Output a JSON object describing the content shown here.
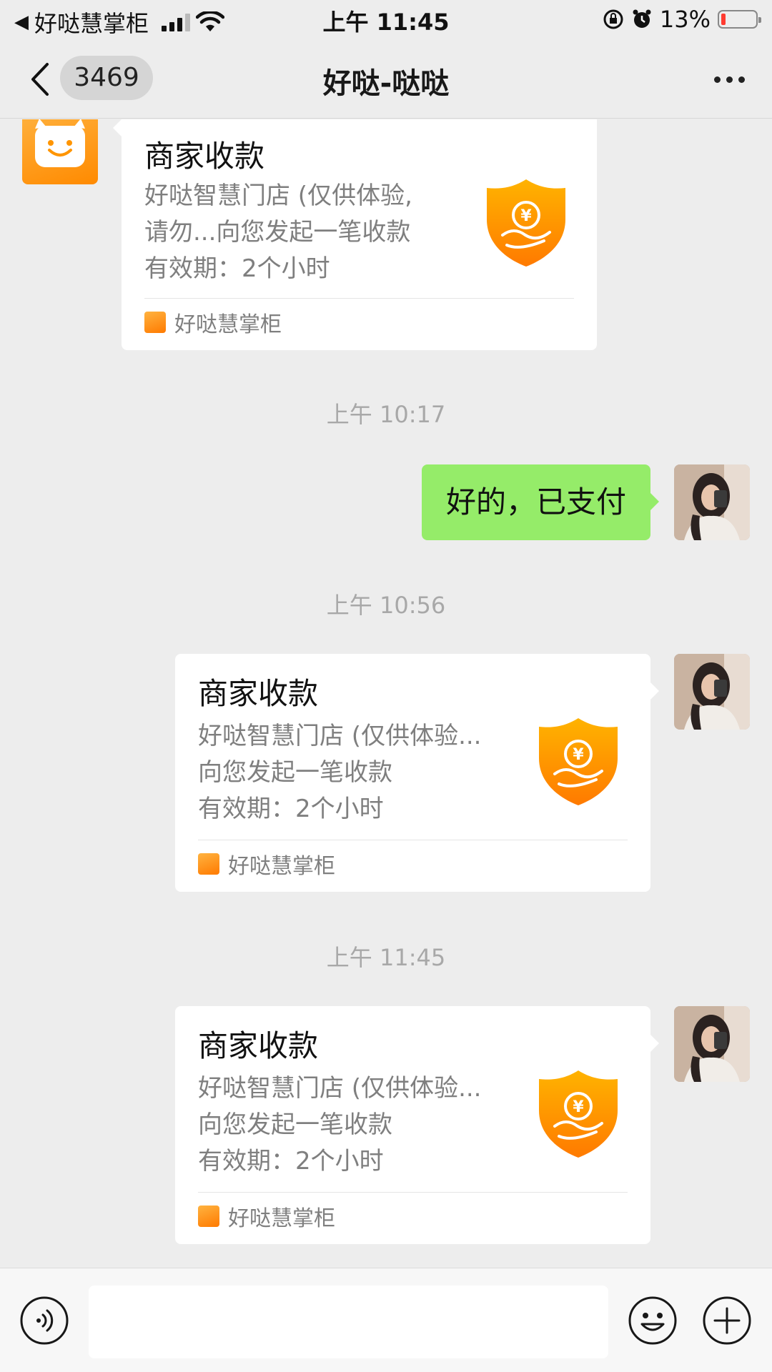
{
  "status": {
    "back_app": "好哒慧掌柜",
    "time": "上午 11:45",
    "battery": "13%",
    "battery_level": 0.13
  },
  "nav": {
    "unread_count": "3469",
    "title": "好哒-哒哒"
  },
  "messages": {
    "card1": {
      "title": "商家收款",
      "desc_line1": "好哒智慧门店 (仅供体验,",
      "desc_line2": "请勿...向您发起一笔收款",
      "desc_line3": "有效期：2个小时",
      "source": "好哒慧掌柜"
    },
    "time1": "上午 10:17",
    "text1": "好的，已支付",
    "time2": "上午 10:56",
    "card2": {
      "title": "商家收款",
      "desc_line1": "好哒智慧门店 (仅供体验...",
      "desc_line2": "向您发起一笔收款",
      "desc_line3": "有效期：2个小时",
      "source": "好哒慧掌柜"
    },
    "time3": "上午 11:45",
    "card3": {
      "title": "商家收款",
      "desc_line1": "好哒智慧门店 (仅供体验...",
      "desc_line2": "向您发起一笔收款",
      "desc_line3": "有效期：2个小时",
      "source": "好哒慧掌柜"
    }
  },
  "colors": {
    "accent_orange": "#ff9500",
    "bubble_green": "#95ec69",
    "background": "#ededed"
  },
  "icons": [
    "back-arrow-icon",
    "more-icon",
    "shield-yuan-icon",
    "voice-icon",
    "emoji-icon",
    "plus-icon"
  ]
}
